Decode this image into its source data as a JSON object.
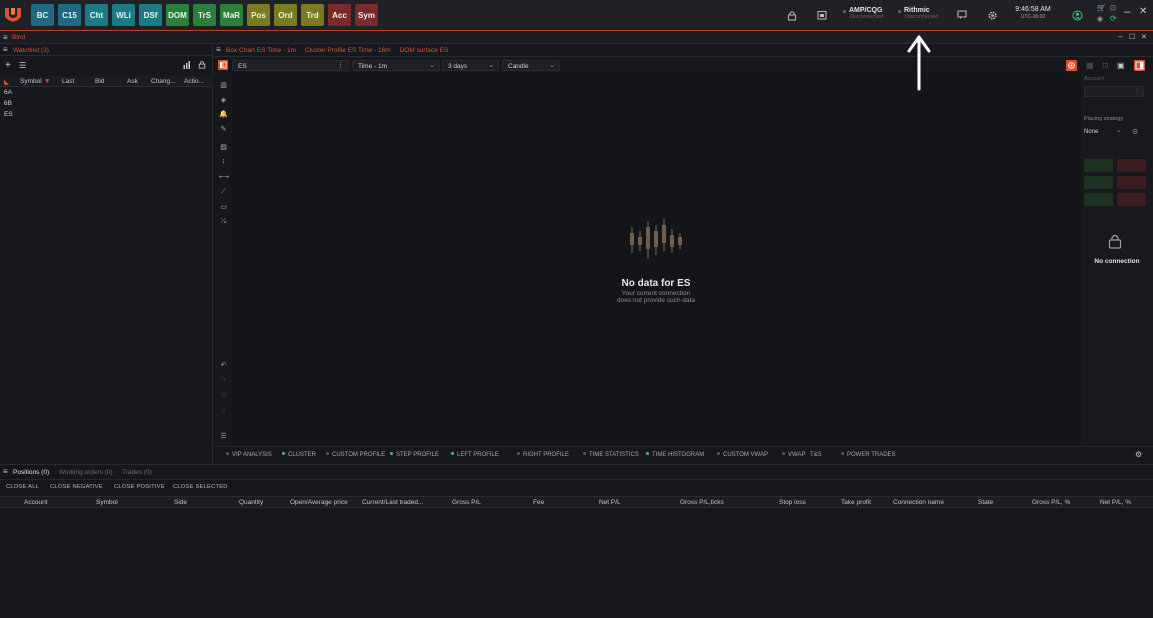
{
  "toolbar": {
    "tools": [
      {
        "label": "BC",
        "bg": "#1f6a80"
      },
      {
        "label": "C15",
        "bg": "#1f6a80"
      },
      {
        "label": "Cht",
        "bg": "#1b7a84"
      },
      {
        "label": "WLi",
        "bg": "#1b7a84"
      },
      {
        "label": "DSf",
        "bg": "#1b7a84"
      },
      {
        "label": "DOM",
        "bg": "#2c7f3a"
      },
      {
        "label": "TrS",
        "bg": "#2c7f3a"
      },
      {
        "label": "MaR",
        "bg": "#2c7f3a"
      },
      {
        "label": "Pos",
        "bg": "#7a7a1e"
      },
      {
        "label": "Ord",
        "bg": "#7a7a1e"
      },
      {
        "label": "Trd",
        "bg": "#7a7a1e"
      },
      {
        "label": "Acc",
        "bg": "#7a2a2a"
      },
      {
        "label": "Sym",
        "bg": "#7a2a2a"
      }
    ],
    "connections": [
      {
        "name": "AMP/CQG",
        "status": "Disconnected"
      },
      {
        "name": "Rithmic",
        "status": "Disconnected"
      }
    ],
    "time": "9:46:58 AM",
    "timezone": "UTC-06:00"
  },
  "workspace": {
    "name": "Blnd"
  },
  "watchlist": {
    "title": "Watchlist (3)",
    "columns": [
      "Symbol",
      "Last",
      "Bid",
      "Ask",
      "Chang...",
      "Actio..."
    ],
    "rows": [
      "6A",
      "6B",
      "ES"
    ]
  },
  "chart": {
    "tabs": [
      "Box Chart ES Time - 1m",
      "Cluster Profile ES Time - 16m",
      "DOM surface ES"
    ],
    "symbol": "ES",
    "timeframe": "Time - 1m",
    "period": "3 days",
    "style": "Candle",
    "empty_title": "No data for ES",
    "empty_line1": "Your current connection",
    "empty_line2": "does not provide such data",
    "indicators": [
      {
        "label": "VIP ANALYSIS",
        "dot": "off"
      },
      {
        "label": "CLUSTER",
        "dot": "on"
      },
      {
        "label": "CUSTOM PROFILE",
        "dot": "off"
      },
      {
        "label": "STEP PROFILE",
        "dot": "on"
      },
      {
        "label": "LEFT PROFILE",
        "dot": "on"
      },
      {
        "label": "RIGHT PROFILE",
        "dot": "off"
      },
      {
        "label": "TIME STATISTICS",
        "dot": "off"
      },
      {
        "label": "TIME HISTOGRAM",
        "dot": "on"
      },
      {
        "label": "CUSTOM VWAP",
        "dot": "off"
      },
      {
        "label": "VWAP",
        "dot": "off"
      },
      {
        "label": "T&S",
        "dot": "none"
      },
      {
        "label": "POWER TRADES",
        "dot": "off"
      }
    ]
  },
  "trade_panel": {
    "account_label": "Account",
    "placing_label": "Placing strategy",
    "placing_value": "None",
    "no_connection": "No connection"
  },
  "positions": {
    "tabs": [
      "Positions (0)",
      "Working orders (0)",
      "Trades (0)"
    ],
    "buttons": [
      "CLOSE ALL",
      "CLOSE NEGATIVE",
      "CLOSE POSITIVE",
      "CLOSE SELECTED"
    ],
    "columns": [
      "Account",
      "Symbol",
      "Side",
      "Quantity",
      "Open/Average price",
      "Current/Last traded...",
      "Gross P/L",
      "Fee",
      "Net P/L",
      "Gross P/L,ticks",
      "Stop loss",
      "Take profit",
      "Connection name",
      "State",
      "Gross P/L, %",
      "Net P/L, %"
    ]
  }
}
